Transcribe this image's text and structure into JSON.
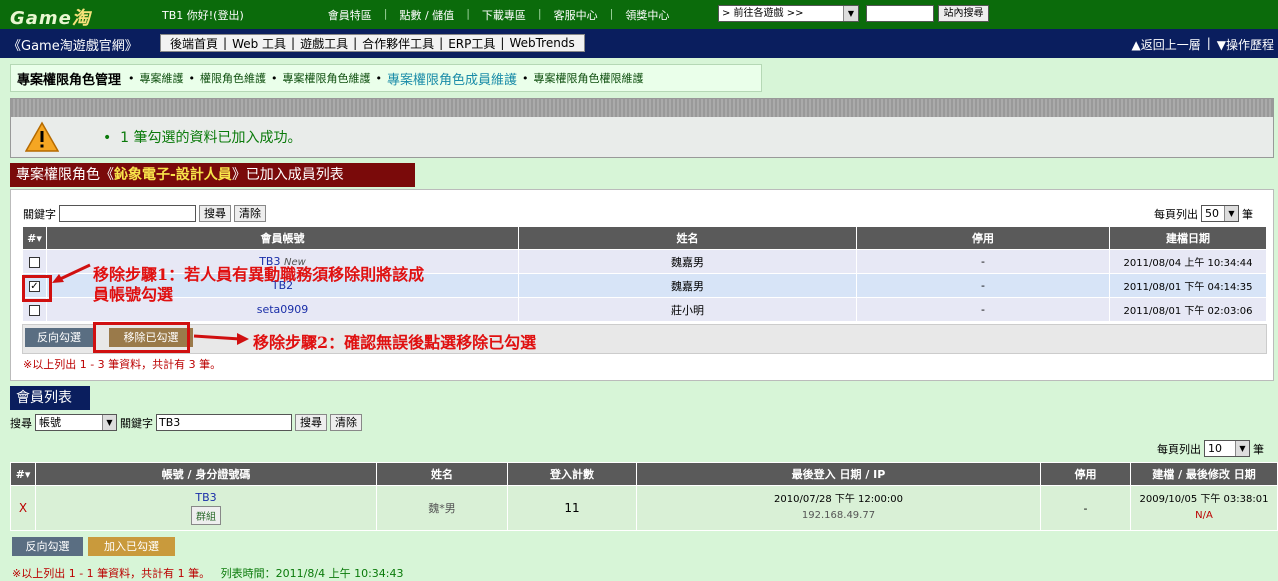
{
  "topbar": {
    "logo_left": "Game",
    "logo_right": "淘",
    "greeting": "TB1 你好!(登出)",
    "links": [
      "會員特區",
      "點數 / 儲值",
      "下載專區",
      "客服中心",
      "領獎中心"
    ],
    "game_select": "> 前往各遊戲 >>",
    "search_button": "站內搜尋"
  },
  "navbar": {
    "brand": "《Game淘遊戲官網》",
    "menu": [
      "後端首頁",
      "Web 工具",
      "遊戲工具",
      "合作夥伴工具",
      "ERP工具",
      "WebTrends"
    ],
    "back": "▲返回上一層",
    "history": "▼操作歷程"
  },
  "breadcrumb": {
    "main": "專案權限角色管理",
    "items": [
      "專案維護",
      "權限角色維護",
      "專案權限角色維護",
      "專案權限角色成員維護",
      "專案權限角色權限維護"
    ]
  },
  "message": {
    "text": "1 筆勾選的資料已加入成功。"
  },
  "members_section": {
    "title_prefix": "專案權限角色《",
    "title_role": "鈊象電子-設計人員",
    "title_suffix": "》已加入成員列表",
    "keyword_label": "關鍵字",
    "search_btn": "搜尋",
    "clear_btn": "清除",
    "perpage_label": "每頁列出",
    "perpage_value": "50",
    "perpage_unit": "筆",
    "columns": [
      "#",
      "會員帳號",
      "姓名",
      "停用",
      "建檔日期"
    ],
    "rows": [
      {
        "account": "TB3",
        "badge": "New",
        "name": "魏嘉男",
        "disabled": "-",
        "created": "2011/08/04 上午 10:34:44",
        "checked": false
      },
      {
        "account": "TB2",
        "badge": "",
        "name": "魏嘉男",
        "disabled": "-",
        "created": "2011/08/01 下午 04:14:35",
        "checked": true
      },
      {
        "account": "seta0909",
        "badge": "",
        "name": "莊小明",
        "disabled": "-",
        "created": "2011/08/01 下午 02:03:06",
        "checked": false
      }
    ],
    "invert_btn": "反向勾選",
    "remove_btn": "移除已勾選",
    "summary": "※以上列出 1 - 3 筆資料，共計有 3 筆。"
  },
  "annotations": {
    "step1_line1": "移除步驟1：若人員有異動職務須移除則將該成",
    "step1_line2": "員帳號勾選",
    "step2": "移除步驟2：確認無誤後點選移除已勾選"
  },
  "member_list": {
    "title": "會員列表",
    "search_label": "搜尋",
    "search_field": "帳號",
    "keyword_label": "關鍵字",
    "keyword_value": "TB3",
    "search_btn": "搜尋",
    "clear_btn": "清除",
    "perpage_label": "每頁列出",
    "perpage_value": "10",
    "perpage_unit": "筆",
    "columns": [
      "#",
      "帳號 / 身分證號碼",
      "姓名",
      "登入計數",
      "最後登入 日期 / IP",
      "停用",
      "建檔 / 最後修改 日期"
    ],
    "rows": [
      {
        "mark": "X",
        "account": "TB3",
        "group_btn": "群組",
        "name": "魏*男",
        "login_count": "11",
        "last_login": "2010/07/28 下午 12:00:00",
        "ip": "192.168.49.77",
        "disabled": "-",
        "created": "2009/10/05 下午 03:38:01",
        "modified": "N/A"
      }
    ],
    "invert_btn": "反向勾選",
    "add_btn": "加入已勾選",
    "summary": "※以上列出 1 - 1 筆資料，共計有 1 筆。",
    "list_time": "列表時間：2011/8/4 上午 10:34:43"
  },
  "colors": {
    "page_bg": "#d7f5d7",
    "topbar": "#0b6b0b",
    "navbar": "#0a1e5e",
    "section_red": "#7a0a0a",
    "section_blue": "#0a1e5e",
    "annotation": "#e01010"
  }
}
